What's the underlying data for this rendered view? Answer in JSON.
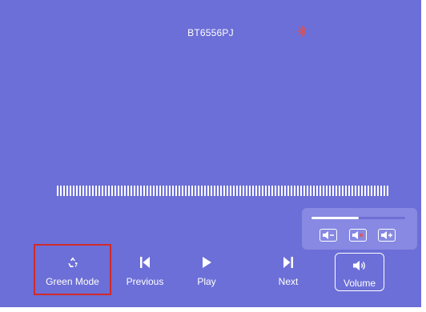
{
  "header": {
    "device_name": "BT6556PJ",
    "bluetooth_icon": "bluetooth-disconnected-icon"
  },
  "progress": {
    "tick_count": 104
  },
  "volume_panel": {
    "level": 0.5,
    "buttons": [
      {
        "icon": "volume-down-icon"
      },
      {
        "icon": "volume-mute-icon"
      },
      {
        "icon": "volume-up-icon"
      }
    ]
  },
  "controls": {
    "green_mode": {
      "label": "Green Mode",
      "icon": "recycle-icon"
    },
    "previous": {
      "label": "Previous",
      "icon": "skip-previous-icon"
    },
    "play": {
      "label": "Play",
      "icon": "play-icon"
    },
    "next": {
      "label": "Next",
      "icon": "skip-next-icon"
    },
    "volume": {
      "label": "Volume",
      "icon": "speaker-icon"
    }
  },
  "colors": {
    "background": "#6c6fd7",
    "panel": "#8789e2",
    "highlight": "#d02a2a",
    "bluetooth_off": "#e2504f"
  }
}
